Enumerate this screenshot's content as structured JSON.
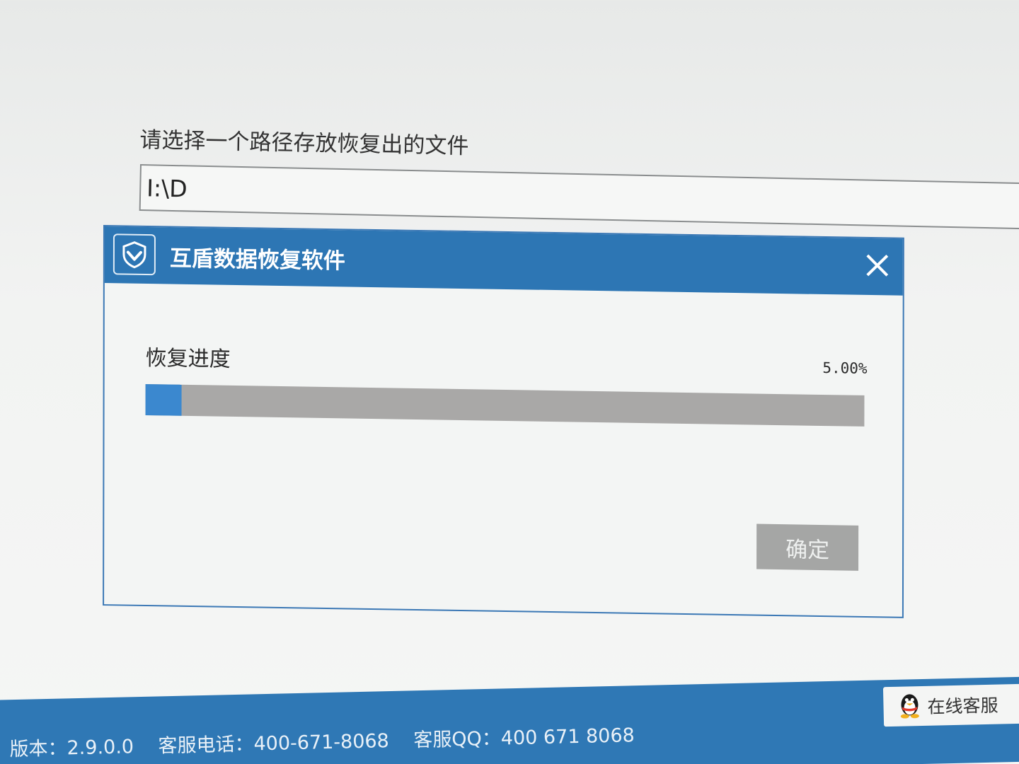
{
  "background": {
    "path_prompt": "请选择一个路径存放恢复出的文件",
    "path_value": "I:\\D"
  },
  "dialog": {
    "title": "互盾数据恢复软件",
    "logo_icon": "shield-icon",
    "close_icon": "close-icon",
    "progress_label": "恢复进度",
    "progress_percent_text": "5.00%",
    "progress_value": 0.05,
    "ok_label": "确定",
    "colors": {
      "titlebar": "#2d76b4",
      "progress_fill": "#3b88cf",
      "progress_track": "#a9a8a7",
      "button_disabled": "#a5a6a5"
    }
  },
  "status_bar": {
    "version": "版本：2.9.0.0",
    "phone": "客服电话：400-671-8068",
    "qq": "客服QQ：400 671 8068",
    "online_service_label": "在线客服",
    "online_service_icon": "qq-penguin-icon"
  }
}
